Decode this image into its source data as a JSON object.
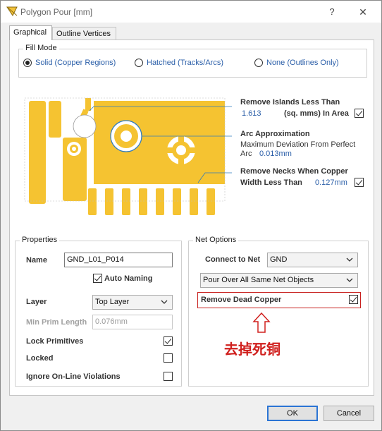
{
  "window": {
    "title": "Polygon Pour [mm]",
    "help_label": "?",
    "close_label": "✕"
  },
  "tabs": [
    {
      "label": "Graphical",
      "active": true
    },
    {
      "label": "Outline Vertices",
      "active": false
    }
  ],
  "fill_mode": {
    "label": "Fill Mode",
    "options": [
      {
        "label": "Solid (Copper Regions)",
        "selected": true
      },
      {
        "label": "Hatched (Tracks/Arcs)",
        "selected": false
      },
      {
        "label": "None (Outlines Only)",
        "selected": false
      }
    ]
  },
  "preview": {
    "copper_color": "#f5c331",
    "remove_islands": {
      "title": "Remove Islands Less Than",
      "value": "1.613",
      "unit": "(sq. mms) In Area",
      "checked": true
    },
    "arc_approx": {
      "title": "Arc Approximation",
      "line1": "Maximum Deviation From Perfect",
      "line2_prefix": "Arc",
      "value": "0.013mm"
    },
    "remove_necks": {
      "title": "Remove Necks When Copper",
      "line2_prefix": "Width Less Than",
      "value": "0.127mm",
      "checked": true
    }
  },
  "properties": {
    "label": "Properties",
    "name_label": "Name",
    "name_value": "GND_L01_P014",
    "auto_naming_label": "Auto Naming",
    "auto_naming_checked": true,
    "layer_label": "Layer",
    "layer_value": "Top Layer",
    "min_prim_label": "Min Prim Length",
    "min_prim_value": "0.076mm",
    "lock_primitives_label": "Lock Primitives",
    "lock_primitives_checked": true,
    "locked_label": "Locked",
    "locked_checked": false,
    "ignore_violations_label": "Ignore On-Line Violations",
    "ignore_violations_checked": false
  },
  "net_options": {
    "label": "Net Options",
    "connect_label": "Connect to Net",
    "connect_value": "GND",
    "pour_mode_value": "Pour Over All Same Net Objects",
    "remove_dead_label": "Remove Dead Copper",
    "remove_dead_checked": true
  },
  "annotation": {
    "note": "去掉死铜",
    "color": "#d0201e"
  },
  "buttons": {
    "ok": "OK",
    "cancel": "Cancel"
  }
}
